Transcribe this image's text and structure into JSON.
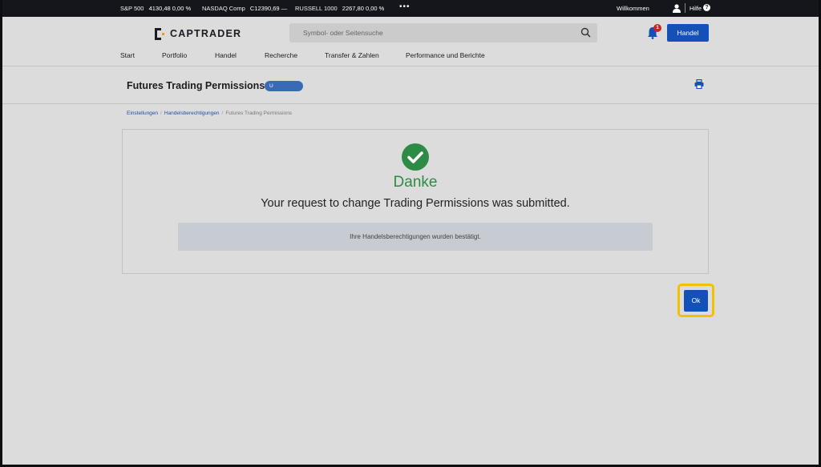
{
  "ticker": {
    "items": [
      {
        "name": "S&P 500",
        "value": "4130,48",
        "change": "0,00 %"
      },
      {
        "name": "NASDAQ Comp",
        "value": "C12390,69",
        "change": "—"
      },
      {
        "name": "RUSSELL 1000",
        "value": "2267,80",
        "change": "0,00 %"
      }
    ],
    "more": "•••",
    "welcome": "Willkommen",
    "help": "Hilfe",
    "help_icon_glyph": "?"
  },
  "header": {
    "logo_text": "CAPTRADER",
    "search_placeholder": "Symbol- oder Seitensuche",
    "notification_count": "1",
    "trade_button": "Handel"
  },
  "nav": {
    "items": [
      "Start",
      "Portfolio",
      "Handel",
      "Recherche",
      "Transfer & Zahlen",
      "Performance und Berichte"
    ]
  },
  "page": {
    "title": "Futures Trading Permissions",
    "account_pill": "U"
  },
  "breadcrumb": {
    "items": [
      "Einstellungen",
      "Handelsberechtigungen",
      "Futures Trading Permissions"
    ]
  },
  "confirmation": {
    "heading": "Danke",
    "message": "Your request to change Trading Permissions was submitted.",
    "notice": "Ihre Handelsberechtigungen wurden bestätigt."
  },
  "actions": {
    "ok_label": "Ok"
  },
  "colors": {
    "accent": "#1350b8",
    "success": "#2e8b46",
    "highlight": "#f2c200"
  },
  "icons": [
    "user-icon",
    "help-icon",
    "search-icon",
    "bell-icon",
    "print-icon",
    "check-circle-icon"
  ]
}
